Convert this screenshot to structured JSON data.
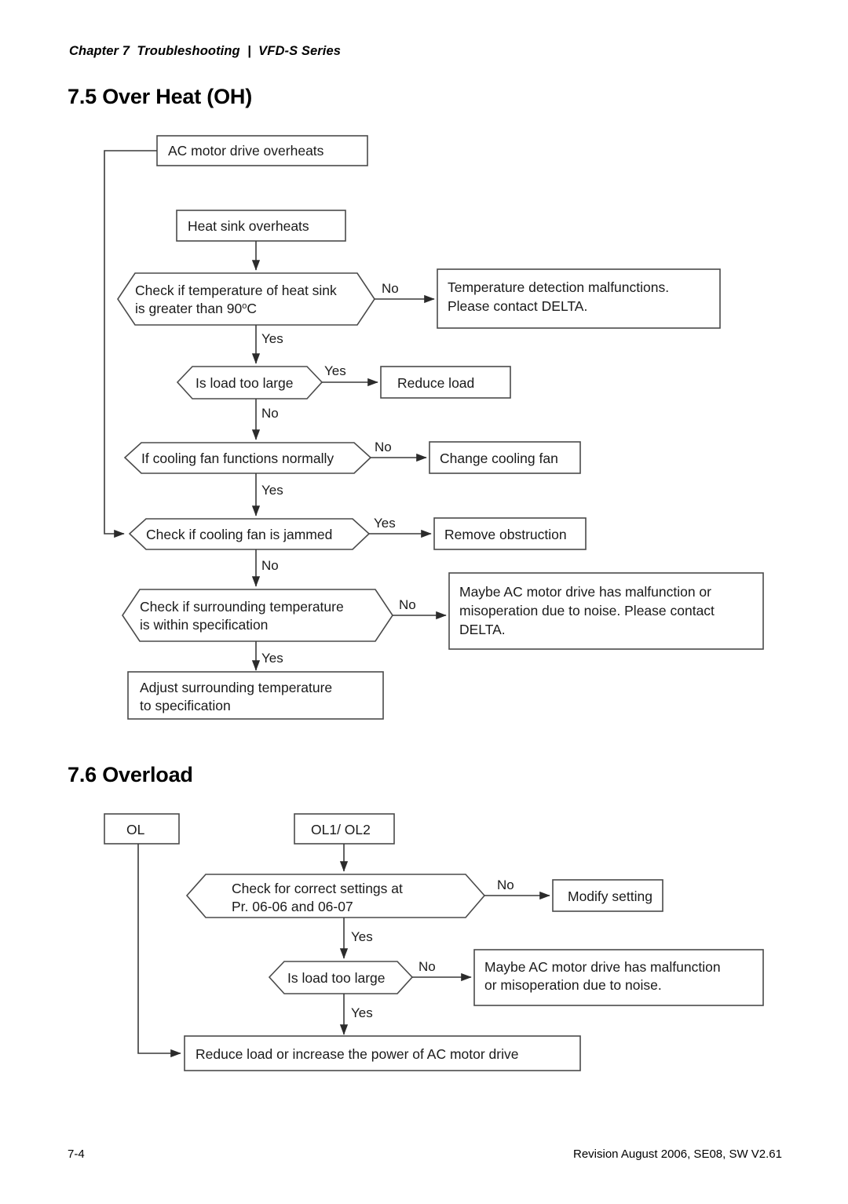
{
  "header": {
    "running_head": "Chapter 7  Troubleshooting  |  VFD-S Series"
  },
  "sections": {
    "over_heat": {
      "heading": "7.5 Over Heat (OH)"
    },
    "overload": {
      "heading": "7.6 Overload"
    }
  },
  "footer": {
    "page_number": "7-4",
    "revision": "Revision August 2006, SE08, SW V2.61"
  },
  "chart_data": [
    {
      "type": "diagram",
      "title": "7.5 Over Heat (OH)",
      "nodes": [
        {
          "id": "oh-start",
          "shape": "rect",
          "text": [
            "AC motor drive overheats"
          ]
        },
        {
          "id": "oh-heatsink",
          "shape": "rect",
          "text": [
            "Heat sink overheats"
          ]
        },
        {
          "id": "oh-temp-check",
          "shape": "hexagon",
          "text": [
            "Check if temperature of heat sink",
            "is greater than 90°C"
          ]
        },
        {
          "id": "oh-temp-malf",
          "shape": "rect",
          "text": [
            "Temperature detection malfunctions.",
            "Please contact  DELTA."
          ]
        },
        {
          "id": "oh-load",
          "shape": "hexagon",
          "text": [
            "Is load too large"
          ]
        },
        {
          "id": "oh-reduce",
          "shape": "rect",
          "text": [
            "Reduce load"
          ]
        },
        {
          "id": "oh-fan-normal",
          "shape": "hexagon",
          "text": [
            "If cooling fan functions normally"
          ]
        },
        {
          "id": "oh-change-fan",
          "shape": "rect",
          "text": [
            "Change cooling fan"
          ]
        },
        {
          "id": "oh-fan-jammed",
          "shape": "hexagon",
          "text": [
            "Check if cooling fan is jammed"
          ]
        },
        {
          "id": "oh-remove-obs",
          "shape": "rect",
          "text": [
            "Remove obstruction"
          ]
        },
        {
          "id": "oh-surround",
          "shape": "hexagon",
          "text": [
            "Check if surrounding temperature",
            "is within specification"
          ]
        },
        {
          "id": "oh-noise",
          "shape": "rect",
          "text": [
            "Maybe AC motor drive has malfunction or",
            "misoperation due to noise. Please contact",
            "DELTA."
          ]
        },
        {
          "id": "oh-adjust",
          "shape": "rect",
          "text": [
            "Adjust surrounding temperature",
            "to specification"
          ]
        }
      ],
      "edges": [
        {
          "from": "oh-heatsink",
          "to": "oh-temp-check",
          "label": ""
        },
        {
          "from": "oh-temp-check",
          "to": "oh-temp-malf",
          "label": "No"
        },
        {
          "from": "oh-temp-check",
          "to": "oh-load",
          "label": "Yes"
        },
        {
          "from": "oh-load",
          "to": "oh-reduce",
          "label": "Yes"
        },
        {
          "from": "oh-load",
          "to": "oh-fan-normal",
          "label": "No"
        },
        {
          "from": "oh-fan-normal",
          "to": "oh-change-fan",
          "label": "No"
        },
        {
          "from": "oh-fan-normal",
          "to": "oh-fan-jammed",
          "label": "Yes"
        },
        {
          "from": "oh-fan-jammed",
          "to": "oh-remove-obs",
          "label": "Yes"
        },
        {
          "from": "oh-fan-jammed",
          "to": "oh-surround",
          "label": "No"
        },
        {
          "from": "oh-surround",
          "to": "oh-noise",
          "label": "No"
        },
        {
          "from": "oh-surround",
          "to": "oh-adjust",
          "label": "Yes"
        },
        {
          "from": "oh-start",
          "to": "oh-fan-jammed",
          "label": ""
        }
      ],
      "labels": {
        "l1": "No",
        "l2": "Yes",
        "l3": "Yes",
        "l4": "No",
        "l5": "No",
        "l6": "Yes",
        "l7": "Yes",
        "l8": "No",
        "l9": "No",
        "l10": "Yes"
      }
    },
    {
      "type": "diagram",
      "title": "7.6 Overload",
      "nodes": [
        {
          "id": "ol-start",
          "shape": "rect",
          "text": [
            "OL"
          ]
        },
        {
          "id": "ol12-start",
          "shape": "rect",
          "text": [
            "OL1/ OL2"
          ]
        },
        {
          "id": "ol-settings",
          "shape": "hexagon",
          "text": [
            "Check for correct settings at",
            "Pr. 06-06 and 06-07"
          ]
        },
        {
          "id": "ol-modify",
          "shape": "rect",
          "text": [
            "Modify setting"
          ]
        },
        {
          "id": "ol-load",
          "shape": "hexagon",
          "text": [
            "Is load too large"
          ]
        },
        {
          "id": "ol-noise",
          "shape": "rect",
          "text": [
            "Maybe AC motor drive has malfunction",
            "or misoperation due to noise."
          ]
        },
        {
          "id": "ol-reduce",
          "shape": "rect",
          "text": [
            "Reduce load or increase the power of AC motor drive"
          ]
        }
      ],
      "edges": [
        {
          "from": "ol12-start",
          "to": "ol-settings",
          "label": ""
        },
        {
          "from": "ol-settings",
          "to": "ol-modify",
          "label": "No"
        },
        {
          "from": "ol-settings",
          "to": "ol-load",
          "label": "Yes"
        },
        {
          "from": "ol-load",
          "to": "ol-noise",
          "label": "No"
        },
        {
          "from": "ol-load",
          "to": "ol-reduce",
          "label": "Yes"
        },
        {
          "from": "ol-start",
          "to": "ol-reduce",
          "label": ""
        }
      ],
      "labels": {
        "m1": "No",
        "m2": "Yes",
        "m3": "No",
        "m4": "Yes"
      }
    }
  ]
}
